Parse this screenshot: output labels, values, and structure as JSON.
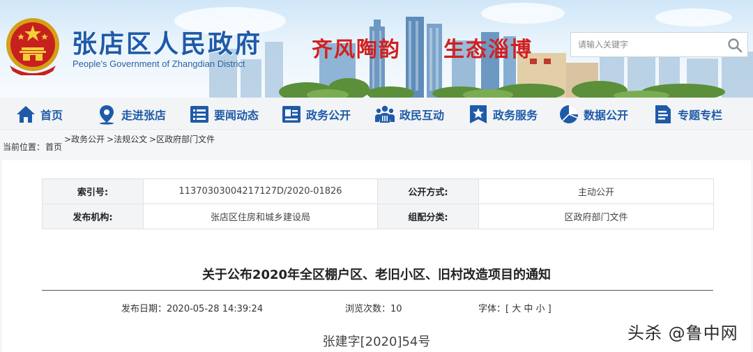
{
  "header": {
    "site_title": "张店区人民政府",
    "site_subtitle": "People's Government of Zhangdian District",
    "slogan_left": "齐风陶韵",
    "slogan_right": "生态淄博",
    "search": {
      "placeholder": "请输入关键字",
      "icon": "search-icon"
    },
    "emblem": "national-emblem",
    "colors": {
      "title": "#1f5aa8",
      "slogan": "#d21f1f"
    }
  },
  "nav": {
    "items": [
      {
        "label": "首页",
        "icon": "home-icon"
      },
      {
        "label": "走进张店",
        "icon": "location-pin-icon"
      },
      {
        "label": "要闻动态",
        "icon": "news-list-icon"
      },
      {
        "label": "政务公开",
        "icon": "id-card-icon"
      },
      {
        "label": "政民互动",
        "icon": "people-icon"
      },
      {
        "label": "政务服务",
        "icon": "star-badge-icon"
      },
      {
        "label": "数据公开",
        "icon": "pie-chart-icon"
      },
      {
        "label": "专题专栏",
        "icon": "document-icon"
      }
    ],
    "color": "#1f5aa8"
  },
  "breadcrumb": {
    "label": "当前位置：",
    "home": "首页",
    "segments": [
      "政务公开",
      "法规公文",
      "区政府部门文件"
    ]
  },
  "meta": {
    "index_key": "索引号:",
    "index_value": "11370303004217127D/2020-01826",
    "open_mode_key": "公开方式:",
    "open_mode_value": "主动公开",
    "publisher_key": "发布机构:",
    "publisher_value": "张店区住房和城乡建设局",
    "category_key": "组配分类:",
    "category_value": "区政府部门文件"
  },
  "article": {
    "title": "关于公布2020年全区棚户区、老旧小区、旧村改造项目的通知",
    "publish_label": "发布日期：",
    "publish_date": "2020-05-28 14:39:24",
    "views_label": "浏览次数：",
    "views": "10",
    "font_label": "字体：",
    "font_control": "[ 大 中 小 ]",
    "doc_number": "张建字[2020]54号"
  },
  "watermark": "头杀 @鲁中网"
}
